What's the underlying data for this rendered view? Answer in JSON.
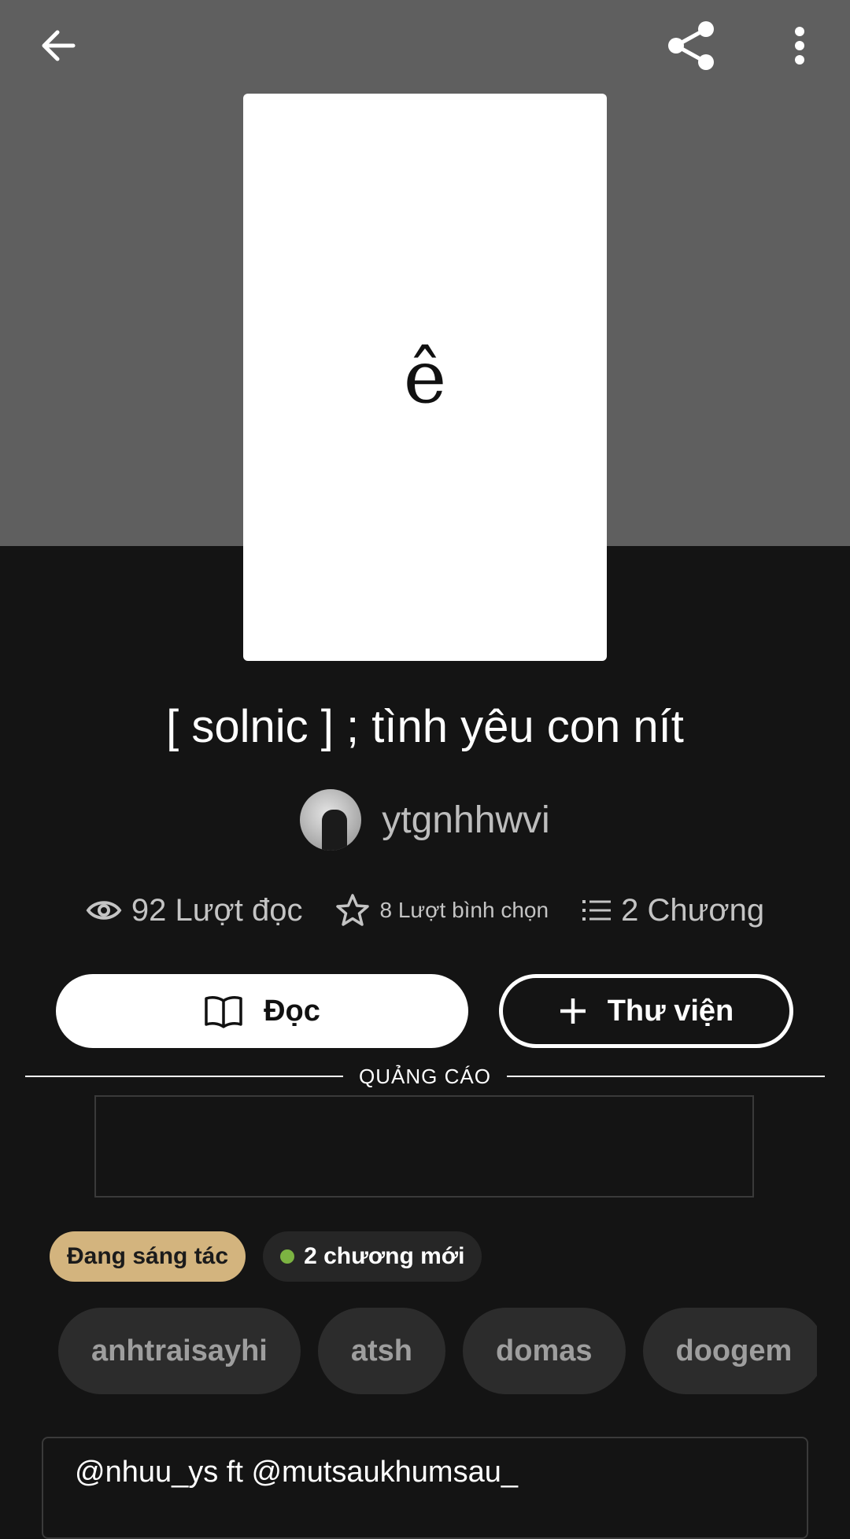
{
  "header": {
    "back_icon": "arrow-left-icon",
    "share_icon": "share-icon",
    "more_icon": "more-vertical-icon"
  },
  "story": {
    "cover_text": "ê",
    "title": "[ solnic ] ; tình yêu con nít",
    "author": "ytgnhhwvi"
  },
  "stats": {
    "reads": "92 Lượt đọc",
    "votes": "8 Lượt bình chọn",
    "chapters": "2 Chương"
  },
  "actions": {
    "read_label": "Đọc",
    "library_label": "Thư viện"
  },
  "ad": {
    "label": "QUẢNG CÁO"
  },
  "status": {
    "state": "Đang sáng tác",
    "new_chapters": "2 chương mới",
    "new_dot_color": "#7cb342"
  },
  "tags": [
    "anhtraisayhi",
    "atsh",
    "domas",
    "doogem"
  ],
  "description": {
    "first_line": "@nhuu_ys ft @mutsaukhumsau_"
  },
  "colors": {
    "header_bg": "#5f5f5f",
    "page_bg": "#141414",
    "status_badge": "#d3b47e"
  }
}
